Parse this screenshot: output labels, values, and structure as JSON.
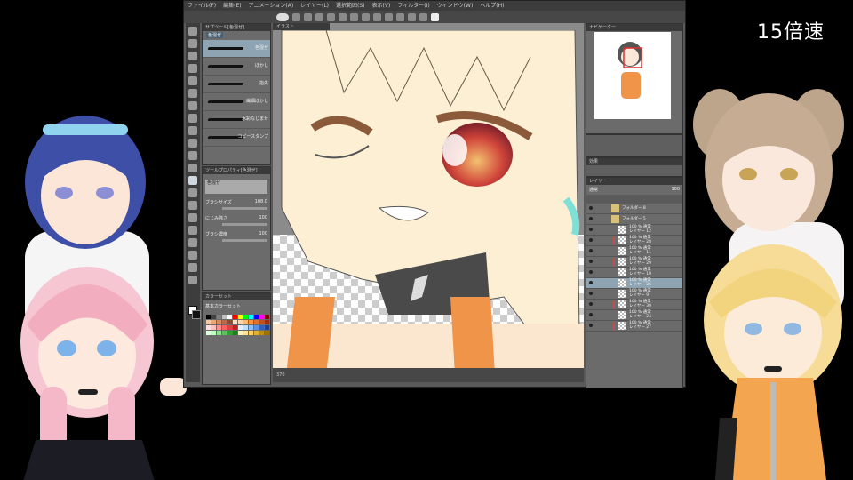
{
  "overlay": {
    "speed_label": "15倍速"
  },
  "app": {
    "menu": [
      "ファイル(F)",
      "編集(E)",
      "アニメーション(A)",
      "レイヤー(L)",
      "選択範囲(S)",
      "表示(V)",
      "フィルター(I)",
      "ウィンドウ(W)",
      "ヘルプ(H)"
    ],
    "subtool_panel": {
      "title": "サブツール[色混ぜ]",
      "active_tab": "色混ぜ",
      "brushes": [
        {
          "label": "色混ぜ",
          "selected": true
        },
        {
          "label": "ぼかし",
          "selected": false
        },
        {
          "label": "指先",
          "selected": false
        },
        {
          "label": "繊細ぼかし",
          "selected": false
        },
        {
          "label": "水彩なじませ",
          "selected": false
        },
        {
          "label": "コピースタンプ",
          "selected": false
        }
      ]
    },
    "tool_property": {
      "title": "ツールプロパティ[色混ぜ]",
      "preview_label": "色混ぜ",
      "brush_size_label": "ブラシサイズ",
      "brush_size_value": "108.0",
      "blend_strength_label": "にじみ強さ",
      "blend_strength_value": "100",
      "brush_density_label": "ブラシ濃度",
      "brush_density_value": "100"
    },
    "color_set": {
      "title": "カラーセット",
      "set_name": "基本カラーセット",
      "colors": [
        "#000000",
        "#404040",
        "#808080",
        "#c0c0c0",
        "#ffffff",
        "#ff0000",
        "#ffff00",
        "#00ff00",
        "#00ffff",
        "#0000ff",
        "#ff00ff",
        "#800000",
        "#f4c9a8",
        "#e8a87c",
        "#d98b5f",
        "#b86b4b",
        "#8c4a32",
        "#f7e0c8",
        "#ffd8b0",
        "#ffb870",
        "#ff9040",
        "#e07030",
        "#c05020",
        "#a03010",
        "#ffe0e0",
        "#ffc0c0",
        "#ff9090",
        "#ff6060",
        "#e04040",
        "#c02020",
        "#e0f0ff",
        "#c0e0ff",
        "#90c0ff",
        "#6090e0",
        "#3060c0",
        "#204090",
        "#e0ffe0",
        "#c0ffc0",
        "#90e090",
        "#60c060",
        "#30a030",
        "#208020",
        "#fff0c0",
        "#ffe090",
        "#ffd060",
        "#e0b030",
        "#c09010",
        "#a07000"
      ]
    },
    "canvas": {
      "tab_label": "イラスト",
      "zoom_label": "370"
    },
    "navigator": {
      "title": "ナビゲーター"
    },
    "effects": {
      "title": "効果"
    },
    "layers": {
      "title": "レイヤー",
      "blend_mode": "通常",
      "opacity": "100",
      "rows": [
        {
          "top": "",
          "name": "フォルダー 8",
          "is_folder": true,
          "red": false,
          "selected": false
        },
        {
          "top": "",
          "name": "フォルダー 5",
          "is_folder": true,
          "red": false,
          "selected": false
        },
        {
          "top": "100 % 通常",
          "name": "レイヤー 12",
          "is_folder": false,
          "red": false,
          "selected": false
        },
        {
          "top": "100 % 通常",
          "name": "レイヤー 28",
          "is_folder": false,
          "red": true,
          "selected": false
        },
        {
          "top": "100 % 通常",
          "name": "レイヤー 11",
          "is_folder": false,
          "red": false,
          "selected": false
        },
        {
          "top": "100 % 通常",
          "name": "レイヤー 29",
          "is_folder": false,
          "red": true,
          "selected": false
        },
        {
          "top": "100 % 通常",
          "name": "レイヤー 10",
          "is_folder": false,
          "red": false,
          "selected": false
        },
        {
          "top": "100 % 通常",
          "name": "レイヤー 26",
          "is_folder": false,
          "red": false,
          "selected": true
        },
        {
          "top": "100 % 通常",
          "name": "レイヤー 9",
          "is_folder": false,
          "red": false,
          "selected": false
        },
        {
          "top": "100 % 通常",
          "name": "レイヤー 30",
          "is_folder": false,
          "red": true,
          "selected": false
        },
        {
          "top": "100 % 通常",
          "name": "レイヤー 24",
          "is_folder": false,
          "red": false,
          "selected": false
        },
        {
          "top": "100 % 通常",
          "name": "レイヤー 27",
          "is_folder": false,
          "red": true,
          "selected": false
        }
      ]
    }
  }
}
